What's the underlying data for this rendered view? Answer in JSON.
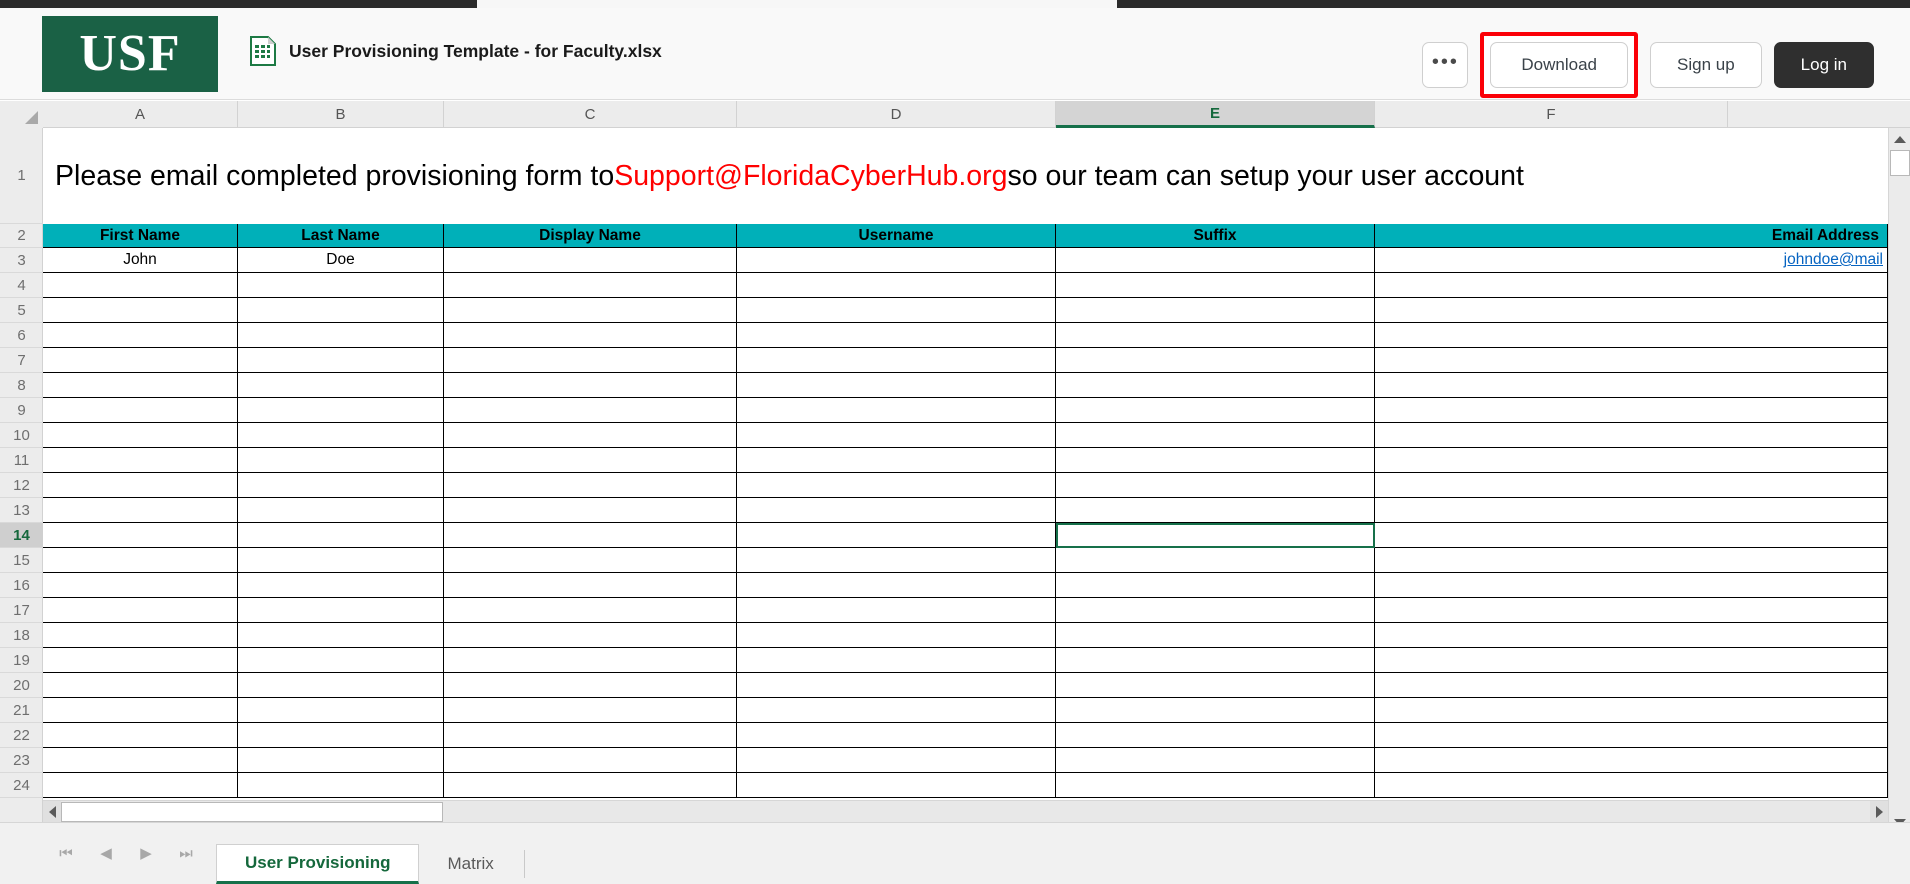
{
  "header": {
    "logo_text": "USF",
    "logo_bg": "#1a6145",
    "doc_icon": "spreadsheet-file-icon",
    "doc_title": "User Provisioning Template - for Faculty.xlsx",
    "more_label": "•••",
    "download_label": "Download",
    "signup_label": "Sign up",
    "login_label": "Log in",
    "highlight_color": "#fb0007"
  },
  "spreadsheet": {
    "accent_color": "#16704a",
    "header_fill": "#00b0b9",
    "link_color": "#0563c1",
    "banner_red": "#ff0000",
    "columns": [
      "A",
      "B",
      "C",
      "D",
      "E",
      "F"
    ],
    "selected_column": "E",
    "selected_row": "14",
    "selected_cell": "E14",
    "rows": [
      "1",
      "2",
      "3",
      "4",
      "5",
      "6",
      "7",
      "8",
      "9",
      "10",
      "11",
      "12",
      "13",
      "14",
      "15",
      "16",
      "17",
      "18",
      "19",
      "20",
      "21",
      "22",
      "23",
      "24"
    ],
    "banner": {
      "pre": "Please email completed provisioning form to ",
      "email": "Support@FloridaCyberHub.org",
      "post": " so our team can setup your user account"
    },
    "column_headers": [
      "First Name",
      "Last Name",
      "Display Name",
      "Username",
      "Suffix",
      "Email Address"
    ],
    "data_row": {
      "first_name": "John",
      "last_name": "Doe",
      "display_name": "",
      "username": "",
      "suffix": "",
      "email": "johndoe@mail"
    }
  },
  "tabbar": {
    "nav": [
      {
        "name": "first-sheet",
        "glyph": "⏮"
      },
      {
        "name": "prev-sheet",
        "glyph": "◀"
      },
      {
        "name": "next-sheet",
        "glyph": "▶"
      },
      {
        "name": "last-sheet",
        "glyph": "⏭"
      }
    ],
    "tabs": [
      {
        "label": "User Provisioning",
        "active": true
      },
      {
        "label": "Matrix",
        "active": false
      }
    ]
  }
}
